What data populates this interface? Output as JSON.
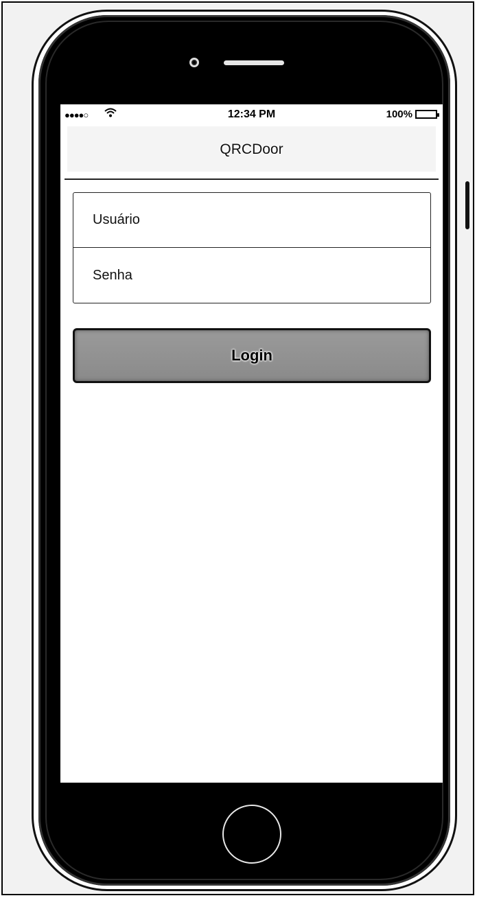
{
  "status_bar": {
    "signal": "●●●●○",
    "wifi_icon": "wifi-icon",
    "time": "12:34 PM",
    "battery_percent": "100%"
  },
  "nav": {
    "title": "QRCDoor"
  },
  "form": {
    "username_placeholder": "Usuário",
    "password_placeholder": "Senha"
  },
  "login_button": {
    "label": "Login"
  },
  "colors": {
    "button_fill": "#909090",
    "nav_background": "#f4f4f4",
    "device_body": "#000000"
  }
}
